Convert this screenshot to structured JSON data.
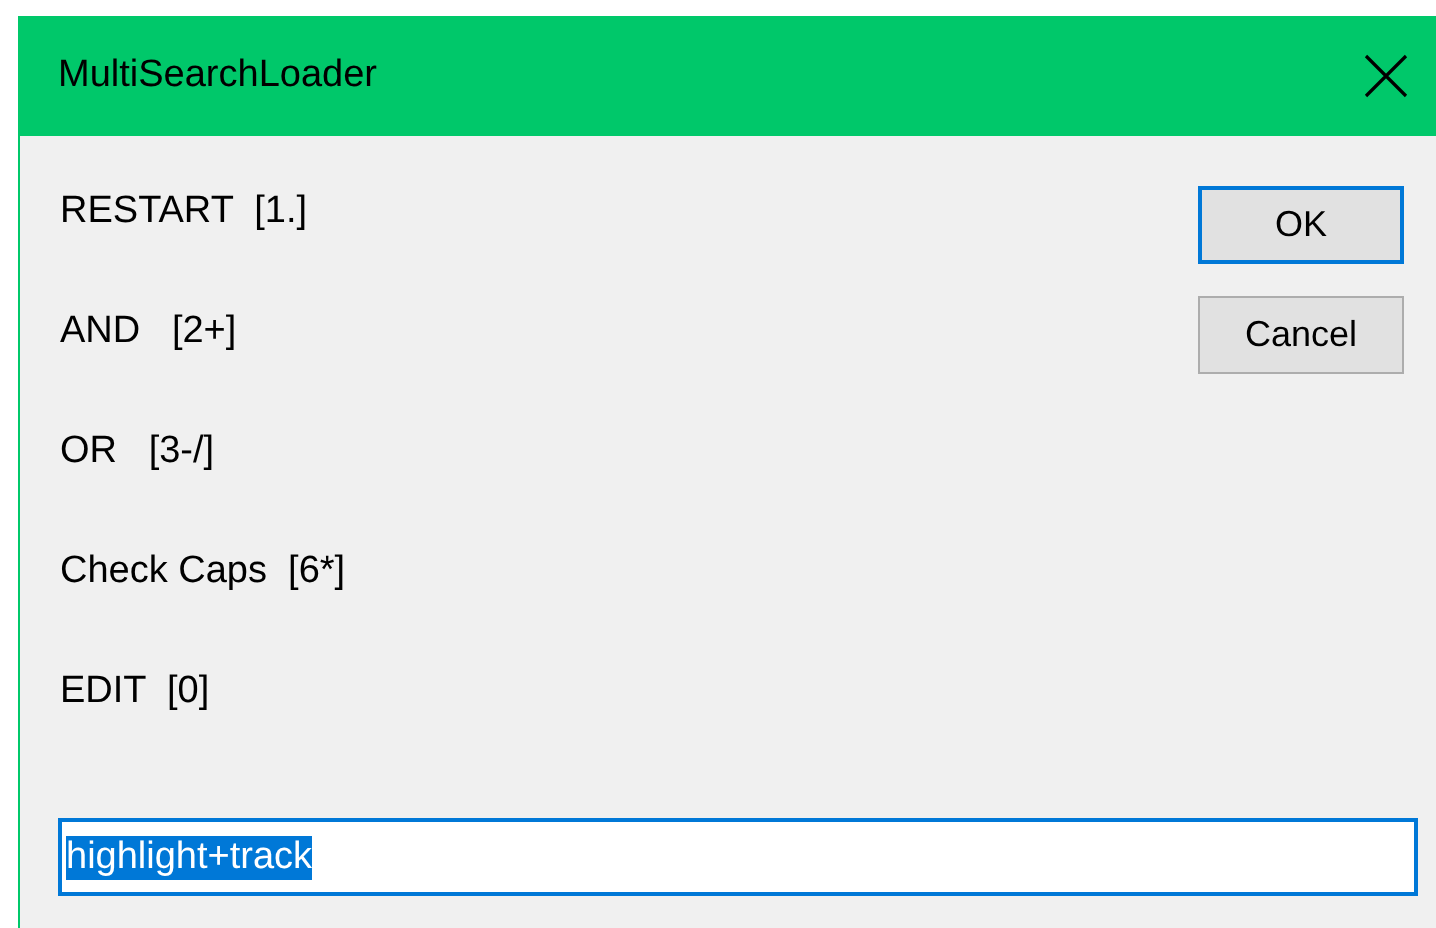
{
  "window": {
    "title": "MultiSearchLoader"
  },
  "options": [
    {
      "label": "RESTART  [1.]"
    },
    {
      "label": "AND   [2+]"
    },
    {
      "label": "OR   [3-/]"
    },
    {
      "label": "Check Caps  [6*]"
    },
    {
      "label": "EDIT  [0]"
    }
  ],
  "buttons": [
    {
      "label": "OK",
      "default": true
    },
    {
      "label": "Cancel",
      "default": false
    }
  ],
  "field": {
    "value": "highlight+track",
    "selected": true
  }
}
